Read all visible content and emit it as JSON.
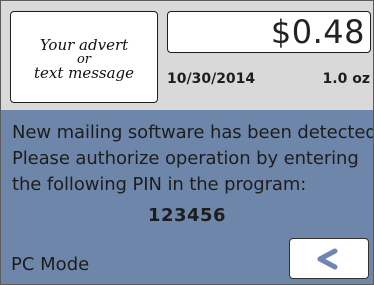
{
  "advert": {
    "line1": "Your advert",
    "line2": "or",
    "line3": "text message"
  },
  "status": {
    "amount": "$0.48",
    "date": "10/30/2014",
    "weight": "1.0 oz"
  },
  "message": {
    "line1": "New mailing software has been detected",
    "line2": "Please authorize operation by entering",
    "line3": "the following PIN in the program:"
  },
  "pin": "123456",
  "mode_label": "PC Mode",
  "back_button": {
    "icon": "back-arrow-icon"
  },
  "colors": {
    "panel_blue": "#6f86ab",
    "icon_blue": "#6d86b3"
  }
}
